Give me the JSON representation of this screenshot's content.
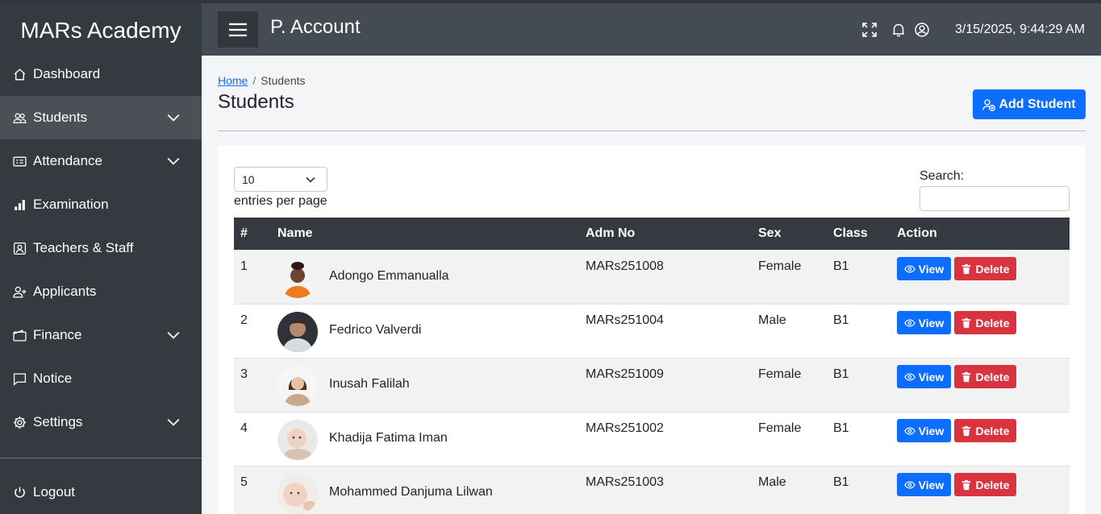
{
  "app": {
    "brand": "MARs Academy",
    "header_title": "P. Account",
    "datetime": "3/15/2025, 9:44:29 AM"
  },
  "sidebar": {
    "items": [
      {
        "label": "Dashboard",
        "icon": "home-icon",
        "has_chevron": false,
        "active": false
      },
      {
        "label": "Students",
        "icon": "users-icon",
        "has_chevron": true,
        "active": true
      },
      {
        "label": "Attendance",
        "icon": "id-card-icon",
        "has_chevron": true,
        "active": false
      },
      {
        "label": "Examination",
        "icon": "bar-chart-icon",
        "has_chevron": false,
        "active": false
      },
      {
        "label": "Teachers & Staff",
        "icon": "person-badge-icon",
        "has_chevron": false,
        "active": false
      },
      {
        "label": "Applicants",
        "icon": "person-plus-icon",
        "has_chevron": false,
        "active": false
      },
      {
        "label": "Finance",
        "icon": "wallet-icon",
        "has_chevron": true,
        "active": false
      },
      {
        "label": "Notice",
        "icon": "chat-icon",
        "has_chevron": false,
        "active": false
      },
      {
        "label": "Settings",
        "icon": "gear-icon",
        "has_chevron": true,
        "active": false
      }
    ],
    "logout": "Logout"
  },
  "breadcrumb": {
    "home": "Home",
    "separator": "/",
    "current": "Students"
  },
  "page": {
    "title": "Students",
    "add_button": "Add Student"
  },
  "table_controls": {
    "entries_value": "10",
    "entries_label": "entries per page",
    "search_label": "Search:",
    "search_value": ""
  },
  "table": {
    "headers": [
      "#",
      "Name",
      "Adm No",
      "Sex",
      "Class",
      "Action"
    ],
    "rows": [
      {
        "num": "1",
        "name": "Adongo Emmanualla",
        "adm": "MARs251008",
        "sex": "Female",
        "class": "B1"
      },
      {
        "num": "2",
        "name": "Fedrico Valverdi",
        "adm": "MARs251004",
        "sex": "Male",
        "class": "B1"
      },
      {
        "num": "3",
        "name": "Inusah Falilah",
        "adm": "MARs251009",
        "sex": "Female",
        "class": "B1"
      },
      {
        "num": "4",
        "name": "Khadija Fatima Iman",
        "adm": "MARs251002",
        "sex": "Female",
        "class": "B1"
      },
      {
        "num": "5",
        "name": "Mohammed Danjuma Lilwan",
        "adm": "MARs251003",
        "sex": "Male",
        "class": "B1"
      }
    ],
    "view_label": "View",
    "delete_label": "Delete"
  },
  "colors": {
    "sidebar_bg": "#343a40",
    "header_bg": "#454b52",
    "primary": "#0d6efd",
    "danger": "#d9333f"
  }
}
